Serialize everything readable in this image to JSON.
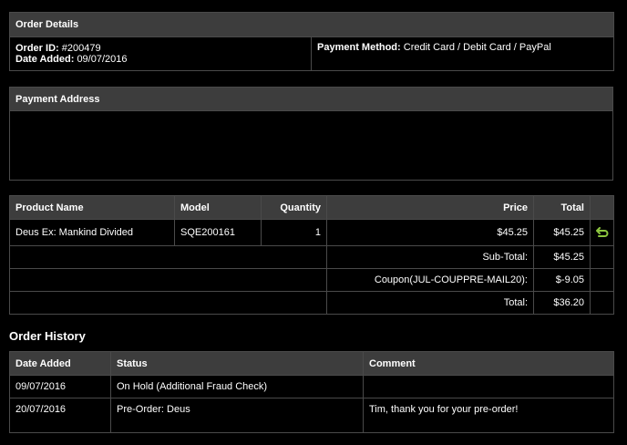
{
  "order_details": {
    "title": "Order Details",
    "order_id_label": "Order ID:",
    "order_id": "#200479",
    "date_added_label": "Date Added:",
    "date_added": "09/07/2016",
    "payment_method_label": "Payment Method:",
    "payment_method": "Credit Card / Debit Card / PayPal"
  },
  "payment_address": {
    "title": "Payment Address",
    "content": ""
  },
  "products": {
    "headers": {
      "product_name": "Product Name",
      "model": "Model",
      "quantity": "Quantity",
      "price": "Price",
      "total": "Total"
    },
    "rows": [
      {
        "product_name": "Deus Ex: Mankind Divided",
        "model": "SQE200161",
        "quantity": "1",
        "price": "$45.25",
        "total": "$45.25"
      }
    ],
    "return_icon": "return-arrow-icon",
    "return_icon_color": "#8dc63f",
    "totals": [
      {
        "label": "Sub-Total:",
        "value": "$45.25"
      },
      {
        "label": "Coupon(JUL-COUPPRE-MAIL20):",
        "value": "$-9.05"
      },
      {
        "label": "Total:",
        "value": "$36.20"
      }
    ]
  },
  "order_history": {
    "title": "Order History",
    "headers": {
      "date_added": "Date Added",
      "status": "Status",
      "comment": "Comment"
    },
    "rows": [
      {
        "date_added": "09/07/2016",
        "status": "On Hold (Additional Fraud Check)",
        "comment": ""
      },
      {
        "date_added": "20/07/2016",
        "status": "Pre-Order: Deus",
        "comment": "Tim, thank you for your pre-order!"
      }
    ]
  },
  "colors": {
    "background": "#000000",
    "header_background": "#3d3d3d",
    "border": "#4a4a4a",
    "text": "#ffffff"
  }
}
